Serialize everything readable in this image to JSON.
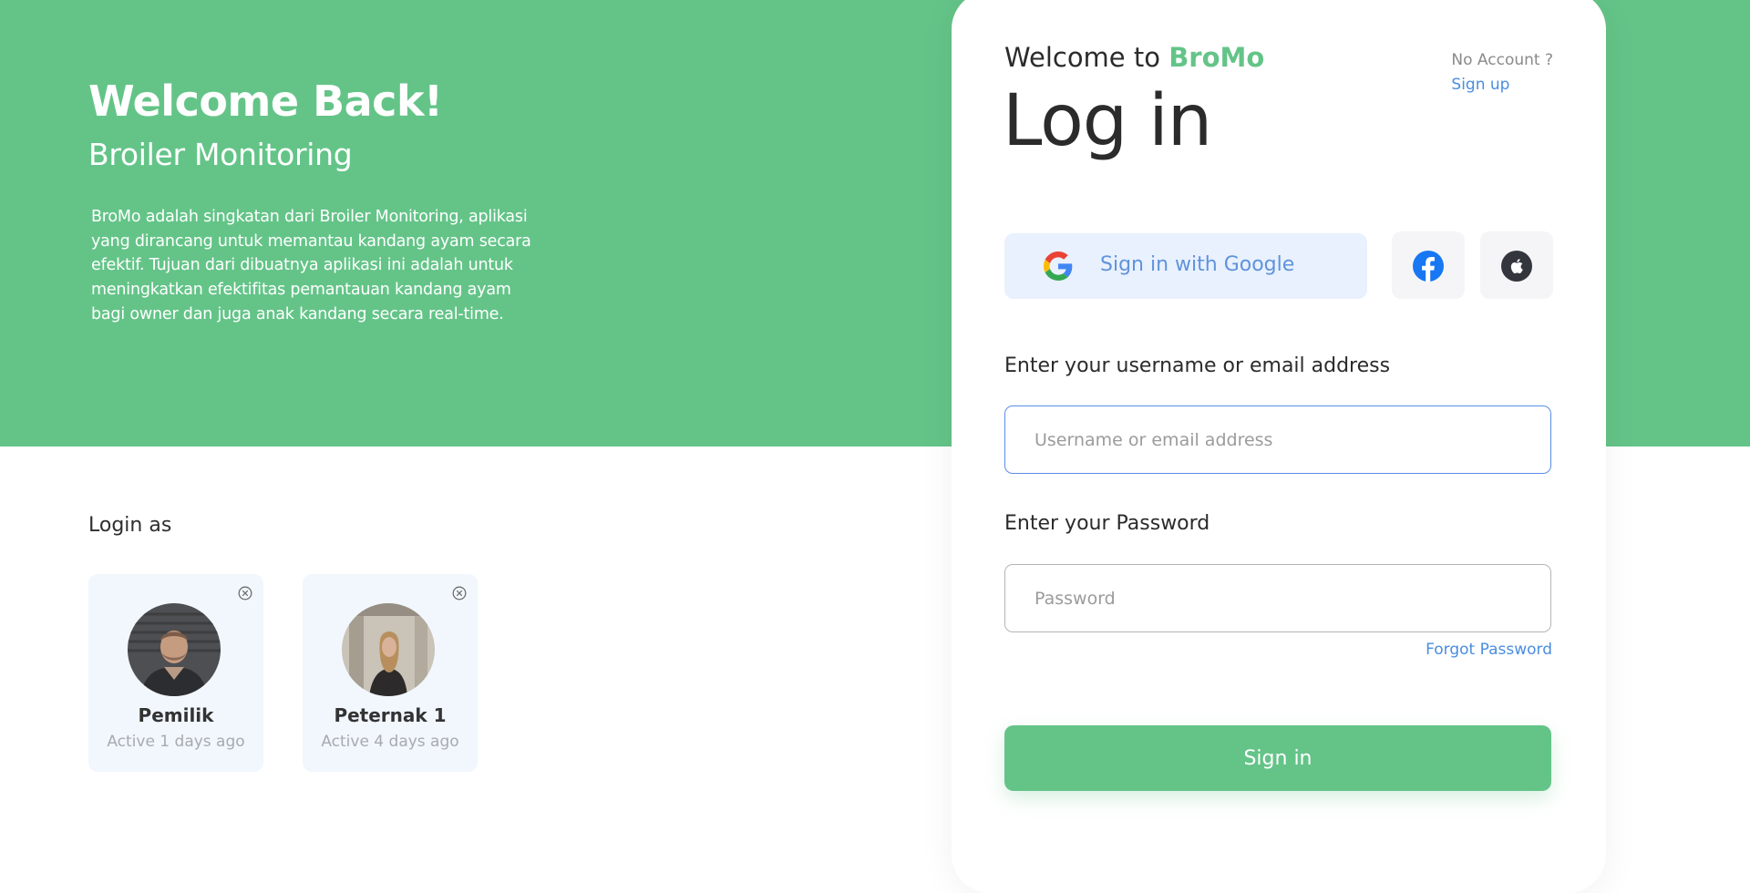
{
  "hero": {
    "title": "Welcome Back!",
    "subtitle": "Broiler Monitoring",
    "description": "BroMo adalah singkatan dari Broiler Monitoring, aplikasi yang dirancang untuk memantau kandang ayam secara efektif. Tujuan dari dibuatnya aplikasi ini adalah untuk meningkatkan efektifitas pemantauan kandang ayam bagi owner dan juga anak kandang secara real-time."
  },
  "login_as": {
    "label": "Login as",
    "accounts": [
      {
        "name": "Pemilik",
        "status": "Active 1 days ago",
        "avatar_icon": "person-avatar-icon"
      },
      {
        "name": "Peternak 1",
        "status": "Active 4 days ago",
        "avatar_icon": "person-avatar-icon"
      }
    ]
  },
  "card": {
    "welcome_prefix": "Welcome to ",
    "brand": "BroMo",
    "no_account": "No Account ?",
    "signup": "Sign up",
    "title": "Log in",
    "google_label": "Sign in with Google",
    "social_icons": [
      "google-icon",
      "facebook-icon",
      "apple-icon"
    ],
    "username_label": "Enter your username or email address",
    "username_placeholder": "Username or email address",
    "username_value": "",
    "password_label": "Enter your Password",
    "password_placeholder": "Password",
    "password_value": "",
    "forgot": "Forgot Password",
    "signin": "Sign in"
  },
  "colors": {
    "brand_green": "#64c488",
    "link_blue": "#4a8de0",
    "google_bg": "#e9f1fe",
    "account_card_bg": "#f1f7fd"
  }
}
